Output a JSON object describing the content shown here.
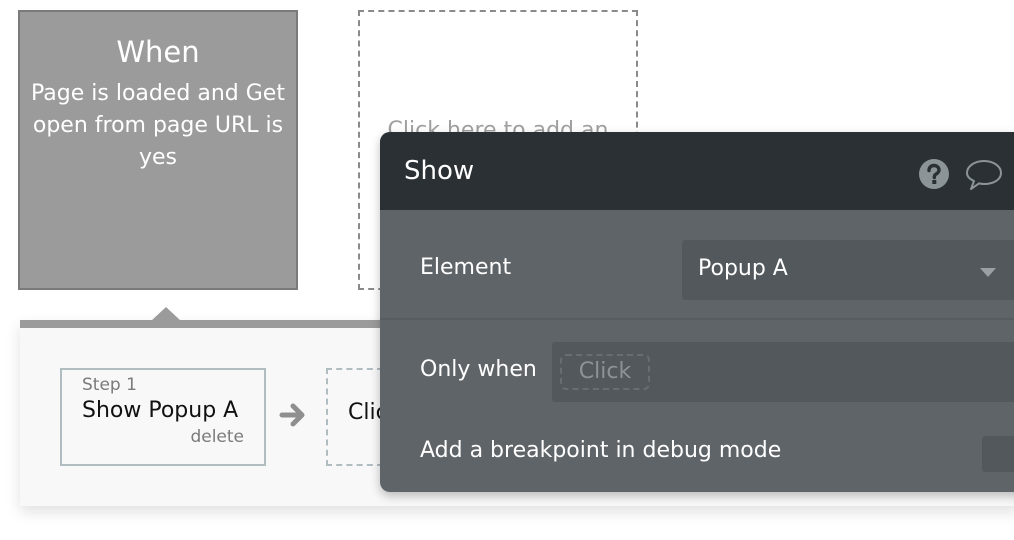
{
  "event": {
    "title": "When",
    "description": "Page is loaded and Get open from page URL is yes"
  },
  "add_event": {
    "text": "Click here to add an"
  },
  "workflow": {
    "steps": [
      {
        "label": "Step 1",
        "name": "Show Popup A",
        "delete_label": "delete"
      }
    ],
    "add_step_text": "Click here to add an action..."
  },
  "panel": {
    "title": "Show",
    "icons": {
      "help": "help-icon",
      "comment": "comment-icon"
    },
    "element": {
      "label": "Element",
      "value": "Popup A"
    },
    "only_when": {
      "label": "Only when",
      "placeholder": "Click"
    },
    "breakpoint": {
      "label": "Add a breakpoint in debug mode",
      "checked": false
    }
  },
  "colors": {
    "event_card_bg": "#9b9b9b",
    "panel_header_bg": "#2a3033",
    "panel_body_bg": "#5f6468",
    "field_bg": "#53585c",
    "strip_bg": "#f8f8f8"
  }
}
